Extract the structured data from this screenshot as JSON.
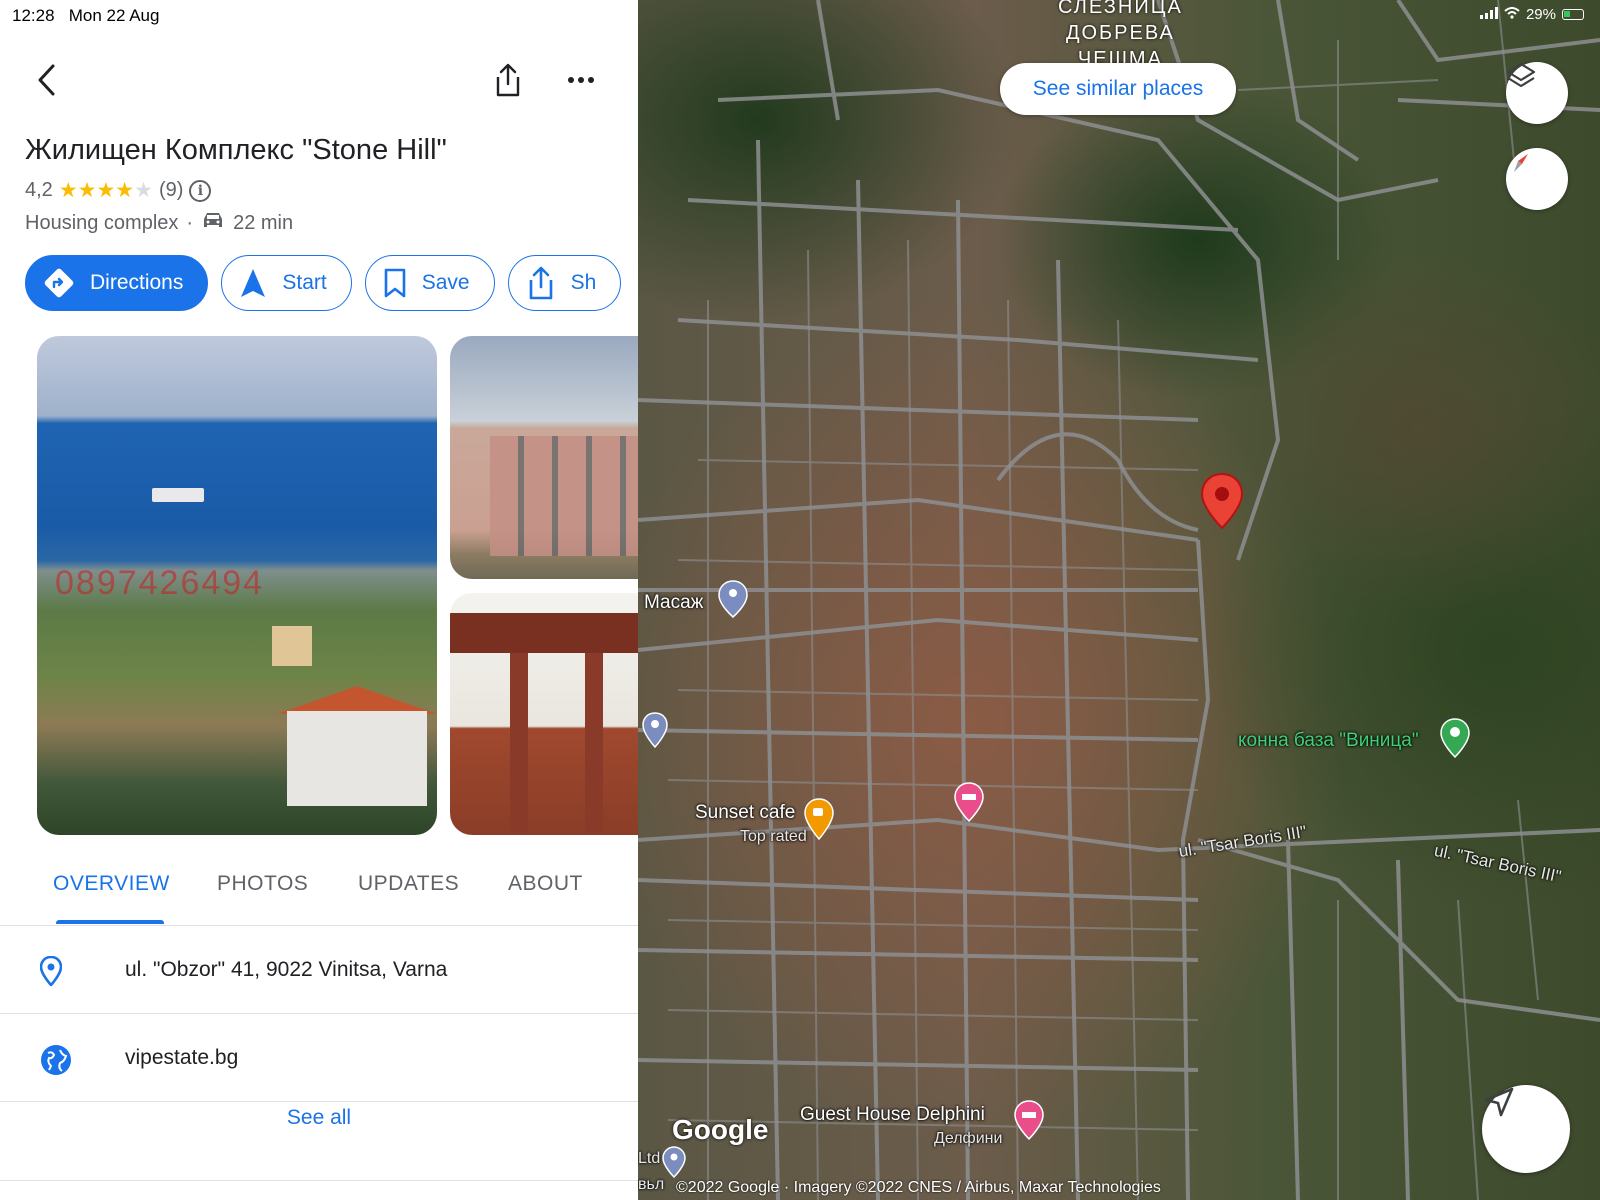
{
  "status_bar": {
    "time": "12:28",
    "date": "Mon 22 Aug",
    "battery": "29%"
  },
  "place": {
    "title": "Жилищен Комплекс \"Stone Hill\"",
    "rating": "4,2",
    "stars_filled": 4,
    "review_count": "(9)",
    "category": "Housing complex",
    "separator": "·",
    "drive_time": "22 min"
  },
  "actions": [
    {
      "label": "Directions",
      "icon": "directions-icon"
    },
    {
      "label": "Start",
      "icon": "navigation-arrow-icon"
    },
    {
      "label": "Save",
      "icon": "bookmark-icon"
    },
    {
      "label": "Sh",
      "icon": "share-icon"
    }
  ],
  "photos": {
    "watermark": "0897426494"
  },
  "tabs": [
    "OVERVIEW",
    "PHOTOS",
    "UPDATES",
    "ABOUT"
  ],
  "details": {
    "address": "ul. \"Obzor\" 41, 9022 Vinitsa, Varna",
    "website": "vipestate.bg",
    "see_all": "See all"
  },
  "map": {
    "see_similar": "See similar places",
    "area_name": [
      "СЛЕЗНИЦА",
      "ДОБРЕВА",
      "ЧЕШМА"
    ],
    "labels": {
      "massage": "Масаж",
      "riding_base": "конна база \"Виница\"",
      "sunset_cafe": "Sunset cafe",
      "top_rated": "Top rated",
      "street_1": "ul. \"Tsar Boris III\"",
      "street_2": "ul. \"Tsar Boris III\"",
      "guest_house": "Guest House Delphini",
      "guest_house_sub": "Делфини",
      "edge_1": "Ltd",
      "edge_2": "вьл"
    },
    "google_logo": "Google",
    "copyright": "©2022 Google · Imagery ©2022 CNES / Airbus, Maxar Technologies"
  },
  "colors": {
    "accent": "#1a73e8",
    "star": "#fbbc04",
    "pin_red": "#ea4335",
    "pin_green": "#34a853",
    "pin_pink": "#e94e8a",
    "pin_orange": "#f29900"
  }
}
